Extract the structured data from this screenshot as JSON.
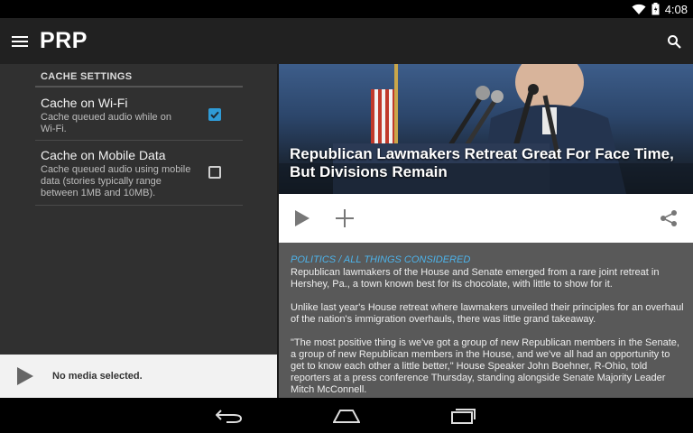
{
  "status_bar": {
    "time": "4:08"
  },
  "app_bar": {
    "title": "PRP"
  },
  "settings": {
    "section_header": "CACHE SETTINGS",
    "items": [
      {
        "title": "Cache on Wi-Fi",
        "summary": "Cache queued audio while on Wi-Fi.",
        "checked": true
      },
      {
        "title": "Cache on Mobile Data",
        "summary": "Cache queued audio using mobile data (stories typically range between 1MB and 10MB).",
        "checked": false
      }
    ]
  },
  "player": {
    "status": "No media selected."
  },
  "article": {
    "title": "Republican Lawmakers Retreat Great For Face Time, But Divisions Remain",
    "category": "POLITICS / ALL THINGS CONSIDERED",
    "paragraphs": [
      "Republican lawmakers of the House and Senate emerged from a rare joint retreat in Hershey, Pa., a town known best for its chocolate, with little to show for it.",
      "Unlike last year's House retreat where lawmakers unveiled their principles for an overhaul of the nation's immigration overhauls, there was little grand takeaway.",
      "\"The most positive thing is we've got a group of new Republican members in the Senate, a group of new Republican members in the House, and we've all had an opportunity to get to know each other a little better,\" House Speaker John Boehner, R-Ohio, told reporters at a press conference Thursday, standing alongside Senate Majority Leader Mitch McConnell."
    ]
  },
  "icons": {
    "menu": "menu-icon",
    "search": "search-icon",
    "play": "play-icon",
    "add": "add-icon",
    "share": "share-icon",
    "back": "back-icon",
    "home": "home-icon",
    "recents": "recents-icon",
    "wifi": "wifi-icon",
    "battery": "battery-icon"
  },
  "colors": {
    "accent": "#2f9bd6",
    "category": "#4db3ea",
    "app_bar": "#212121"
  }
}
